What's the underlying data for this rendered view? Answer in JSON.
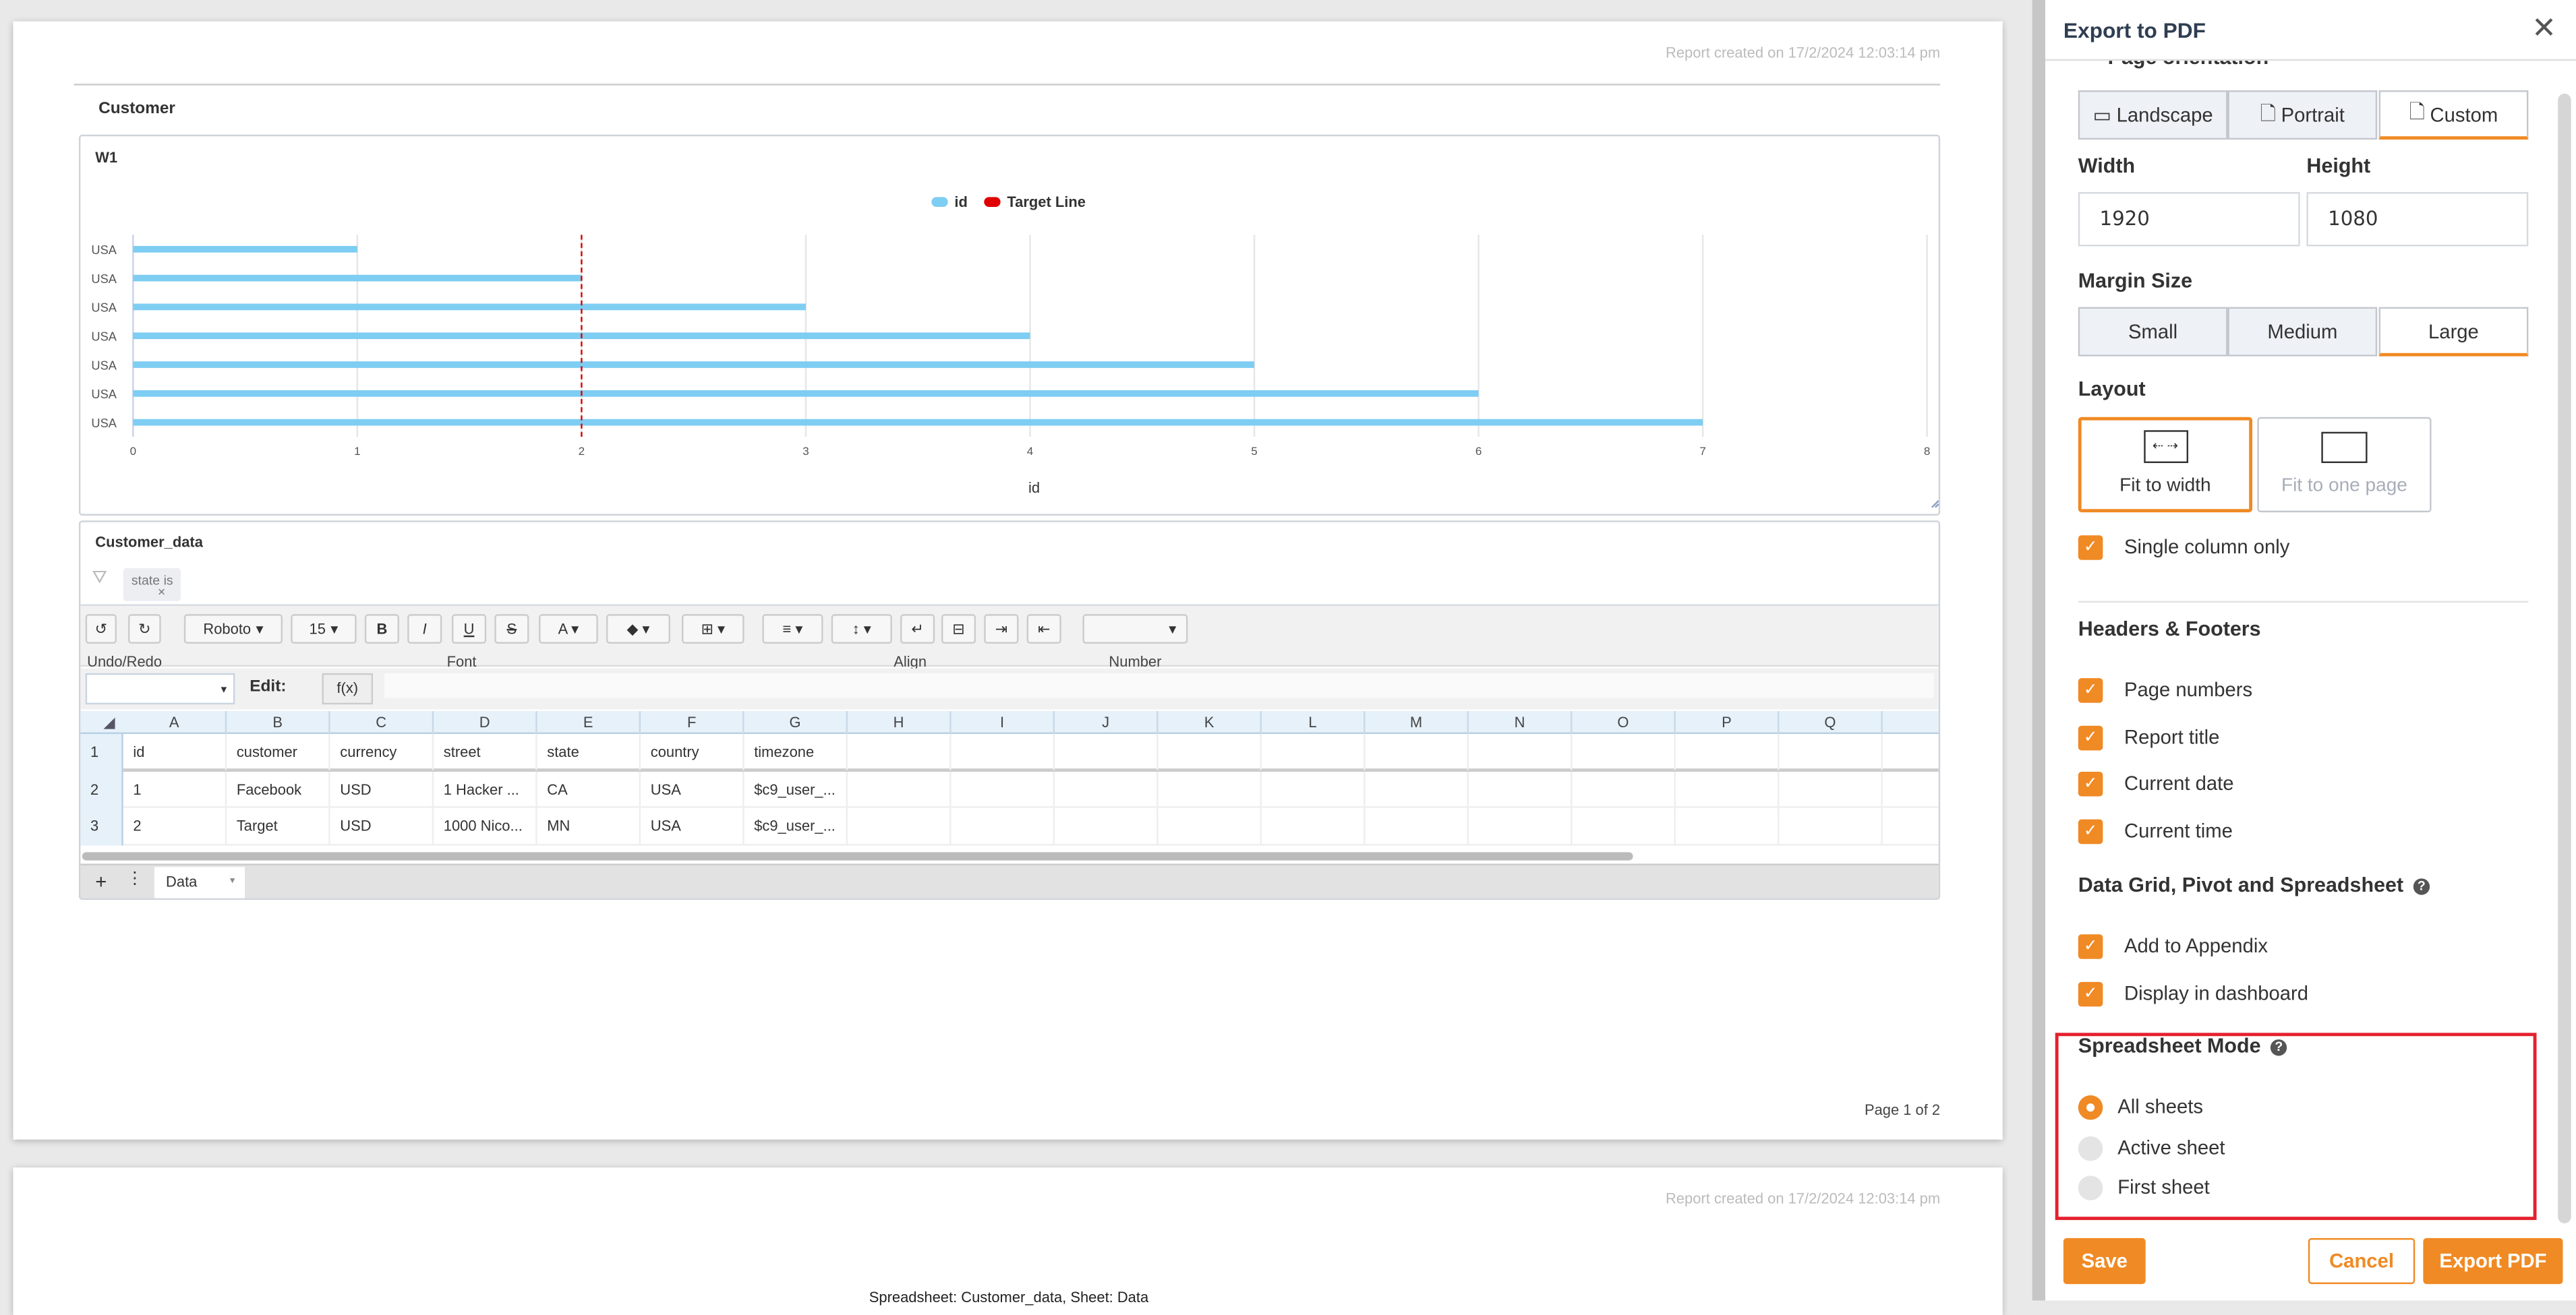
{
  "report": {
    "created": "Report created on 17/2/2024 12:03:14 pm",
    "section_title": "Customer",
    "page_footer": "Page 1 of 2",
    "page2_partial_text": "Spreadsheet: Customer_data, Sheet: Data"
  },
  "chart_widget": {
    "title": "W1"
  },
  "chart_data": {
    "type": "bar",
    "orientation": "horizontal",
    "categories": [
      "USA",
      "USA",
      "USA",
      "USA",
      "USA",
      "USA",
      "USA"
    ],
    "series": [
      {
        "name": "id",
        "values": [
          1,
          2,
          3,
          4,
          5,
          6,
          7
        ],
        "color": "#7ecdf2"
      }
    ],
    "target_line": {
      "name": "Target Line",
      "value": 2,
      "color": "#e00000",
      "style": "dashed"
    },
    "xlabel": "id",
    "xlim": [
      0,
      8
    ],
    "xticks": [
      "0",
      "1",
      "2",
      "3",
      "4",
      "5",
      "6",
      "7",
      "8"
    ],
    "grid": true,
    "legend": "top-center"
  },
  "spreadsheet": {
    "title": "Customer_data",
    "filter_chip": "state is",
    "toolbar": {
      "font": "Roboto",
      "size": "15",
      "bold": "B",
      "italic": "I",
      "underline": "U",
      "strike": "S",
      "groups": [
        "Undo/Redo",
        "Font",
        "Align",
        "Number"
      ]
    },
    "formula": {
      "edit_label": "Edit:",
      "fx": "f(x)"
    },
    "columns": [
      "A",
      "B",
      "C",
      "D",
      "E",
      "F",
      "G",
      "H",
      "I",
      "J",
      "K",
      "L",
      "M",
      "N",
      "O",
      "P",
      "Q"
    ],
    "rows": [
      [
        "id",
        "customer",
        "currency",
        "street",
        "state",
        "country",
        "timezone"
      ],
      [
        "1",
        "Facebook",
        "USD",
        "1 Hacker ...",
        "CA",
        "USA",
        "$c9_user_..."
      ],
      [
        "2",
        "Target",
        "USD",
        "1000 Nico...",
        "MN",
        "USA",
        "$c9_user_..."
      ]
    ],
    "row_numbers": [
      "1",
      "2",
      "3"
    ],
    "sheet_tab": "Data"
  },
  "panel": {
    "title": "Export to PDF",
    "orientation_label": "Page orientation",
    "orientation": [
      "Landscape",
      "Portrait",
      "Custom"
    ],
    "width_label": "Width",
    "height_label": "Height",
    "width": "1920",
    "height": "1080",
    "margin_label": "Margin Size",
    "margins": [
      "Small",
      "Medium",
      "Large"
    ],
    "layout_label": "Layout",
    "layouts": [
      "Fit to width",
      "Fit to one page"
    ],
    "single_column": "Single column only",
    "headers_label": "Headers & Footers",
    "headers": [
      "Page numbers",
      "Report title",
      "Current date",
      "Current time"
    ],
    "datagrid_label": "Data Grid, Pivot and Spreadsheet",
    "datagrid": [
      "Add to Appendix",
      "Display in dashboard"
    ],
    "sheet_mode_label": "Spreadsheet Mode",
    "sheet_modes": [
      "All sheets",
      "Active sheet",
      "First sheet"
    ],
    "save": "Save",
    "cancel": "Cancel",
    "export": "Export PDF",
    "accent": "#f08a24"
  }
}
